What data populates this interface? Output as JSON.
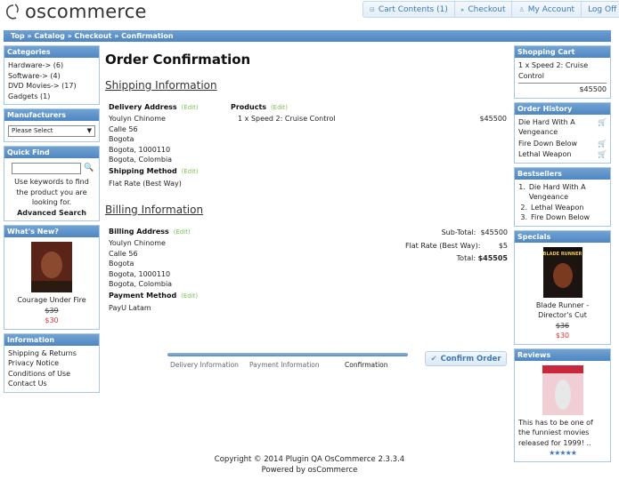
{
  "header": {
    "logo_text": "oscommerce",
    "nav": [
      {
        "label": "Cart Contents (1)",
        "icon": "cart-icon"
      },
      {
        "label": "Checkout",
        "icon": "arrow-right-icon"
      },
      {
        "label": "My Account",
        "icon": "person-icon"
      },
      {
        "label": "Log Off",
        "icon": ""
      }
    ]
  },
  "breadcrumb": "Top » Catalog » Checkout » Confirmation",
  "left": {
    "categories": {
      "title": "Categories",
      "items": [
        "Hardware-> (6)",
        "Software-> (4)",
        "DVD Movies-> (17)",
        "Gadgets (1)"
      ]
    },
    "manufacturers": {
      "title": "Manufacturers",
      "select_value": "Please Select"
    },
    "quick_find": {
      "title": "Quick Find",
      "help": "Use keywords to find the product you are looking for.",
      "advanced": "Advanced Search"
    },
    "whats_new": {
      "title": "What's New?",
      "product": "Courage Under Fire",
      "old_price": "$39",
      "new_price": "$30"
    },
    "information": {
      "title": "Information",
      "items": [
        "Shipping & Returns",
        "Privacy Notice",
        "Conditions of Use",
        "Contact Us"
      ]
    }
  },
  "main": {
    "title": "Order Confirmation",
    "shipping_section": "Shipping Information",
    "delivery_label": "Delivery Address",
    "edit": "(Edit)",
    "delivery_address": [
      "Youlyn Chinome",
      "Calle 56",
      "Bogota",
      "Bogota, 1000110",
      "Bogota, Colombia"
    ],
    "shipping_method_label": "Shipping Method",
    "shipping_method": "Flat Rate (Best Way)",
    "products_label": "Products",
    "product_line": "1 x Speed 2: Cruise Control",
    "product_price": "$45500",
    "billing_section": "Billing Information",
    "billing_label": "Billing Address",
    "billing_address": [
      "Youlyn Chinome",
      "Calle 56",
      "Bogota",
      "Bogota, 1000110",
      "Bogota, Colombia"
    ],
    "payment_label": "Payment Method",
    "payment_method": "PayU Latam",
    "totals": [
      {
        "label": "Sub-Total:",
        "value": "$45500",
        "bold": false
      },
      {
        "label": "Flat Rate (Best Way):",
        "value": "$5",
        "bold": false
      },
      {
        "label": "Total:",
        "value": "$45505",
        "bold": true
      }
    ],
    "progress": {
      "steps": [
        "Delivery Information",
        "Payment Information",
        "Confirmation"
      ],
      "current": 2
    },
    "confirm_button": "Confirm Order"
  },
  "right": {
    "cart": {
      "title": "Shopping Cart",
      "line": "1 x Speed 2: Cruise Control",
      "total": "$45500"
    },
    "history": {
      "title": "Order History",
      "items": [
        "Die Hard With A Vengeance",
        "Fire Down Below",
        "Lethal Weapon"
      ]
    },
    "bestsellers": {
      "title": "Bestsellers",
      "items": [
        "Die Hard With A Vengeance",
        "Lethal Weapon",
        "Fire Down Below"
      ]
    },
    "specials": {
      "title": "Specials",
      "product": "Blade Runner - Director's Cut",
      "old_price": "$36",
      "new_price": "$30",
      "cover_text": "BLADE RUNNER"
    },
    "reviews": {
      "title": "Reviews",
      "text": "This has to be one of the funniest movies released for 1999! ..",
      "stars": "★★★★★"
    }
  },
  "footer": {
    "line1": "Copyright © 2014 Plugin QA OsCommerce 2.3.3.4",
    "line2": "Powered by osCommerce"
  },
  "colors": {
    "accent": "#4f86c1",
    "edit": "#7fc058",
    "price_red": "#dd3333"
  }
}
